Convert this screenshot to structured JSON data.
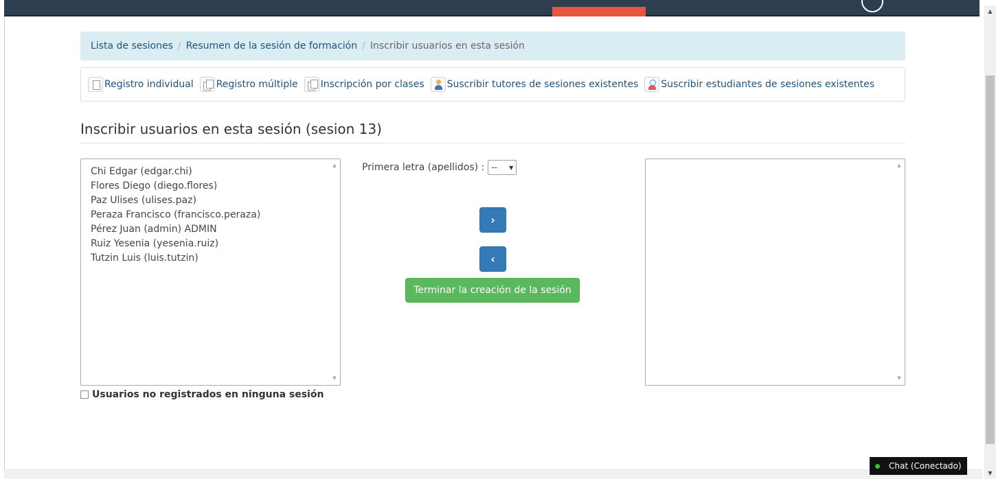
{
  "breadcrumb": {
    "items": [
      {
        "label": "Lista de sesiones"
      },
      {
        "label": "Resumen de la sesión de formación"
      }
    ],
    "current": "Inscribir usuarios en esta sesión",
    "separator": "/"
  },
  "actions": [
    {
      "label": "Registro individual",
      "icon": "document-icon"
    },
    {
      "label": "Registro múltiple",
      "icon": "documents-icon"
    },
    {
      "label": "Inscripción por clases",
      "icon": "documents-icon"
    },
    {
      "label": "Suscribir tutores de sesiones existentes",
      "icon": "tutor-icon"
    },
    {
      "label": "Suscribir estudiantes de sesiones existentes",
      "icon": "student-icon"
    }
  ],
  "page_title": "Inscribir usuarios en esta sesión (sesion 13)",
  "available_users": [
    "Chi Edgar (edgar.chi)",
    "Flores Diego (diego.flores)",
    "Paz Ulises (ulises.paz)",
    "Peraza Francisco (francisco.peraza)",
    "Pérez Juan (admin) ADMIN",
    "Ruiz Yesenia (yesenia.ruiz)",
    "Tutzin Luis (luis.tutzin)"
  ],
  "selected_users": [],
  "letter_filter": {
    "label": "Primera letra (apellidos) :",
    "selected": "--"
  },
  "buttons": {
    "add_symbol": "›",
    "remove_symbol": "‹",
    "finish_label": "Terminar la creación de la sesión"
  },
  "checkbox": {
    "label": "Usuarios no registrados en ninguna sesión",
    "checked": false
  },
  "chat": {
    "label": "Chat (Conectado)",
    "status_color": "#3cc03c"
  },
  "colors": {
    "primary": "#337ab7",
    "success": "#5cb85c",
    "breadcrumb_bg": "#d9edf3",
    "topbar": "#2c3e50",
    "accent_tab": "#e9543f"
  }
}
